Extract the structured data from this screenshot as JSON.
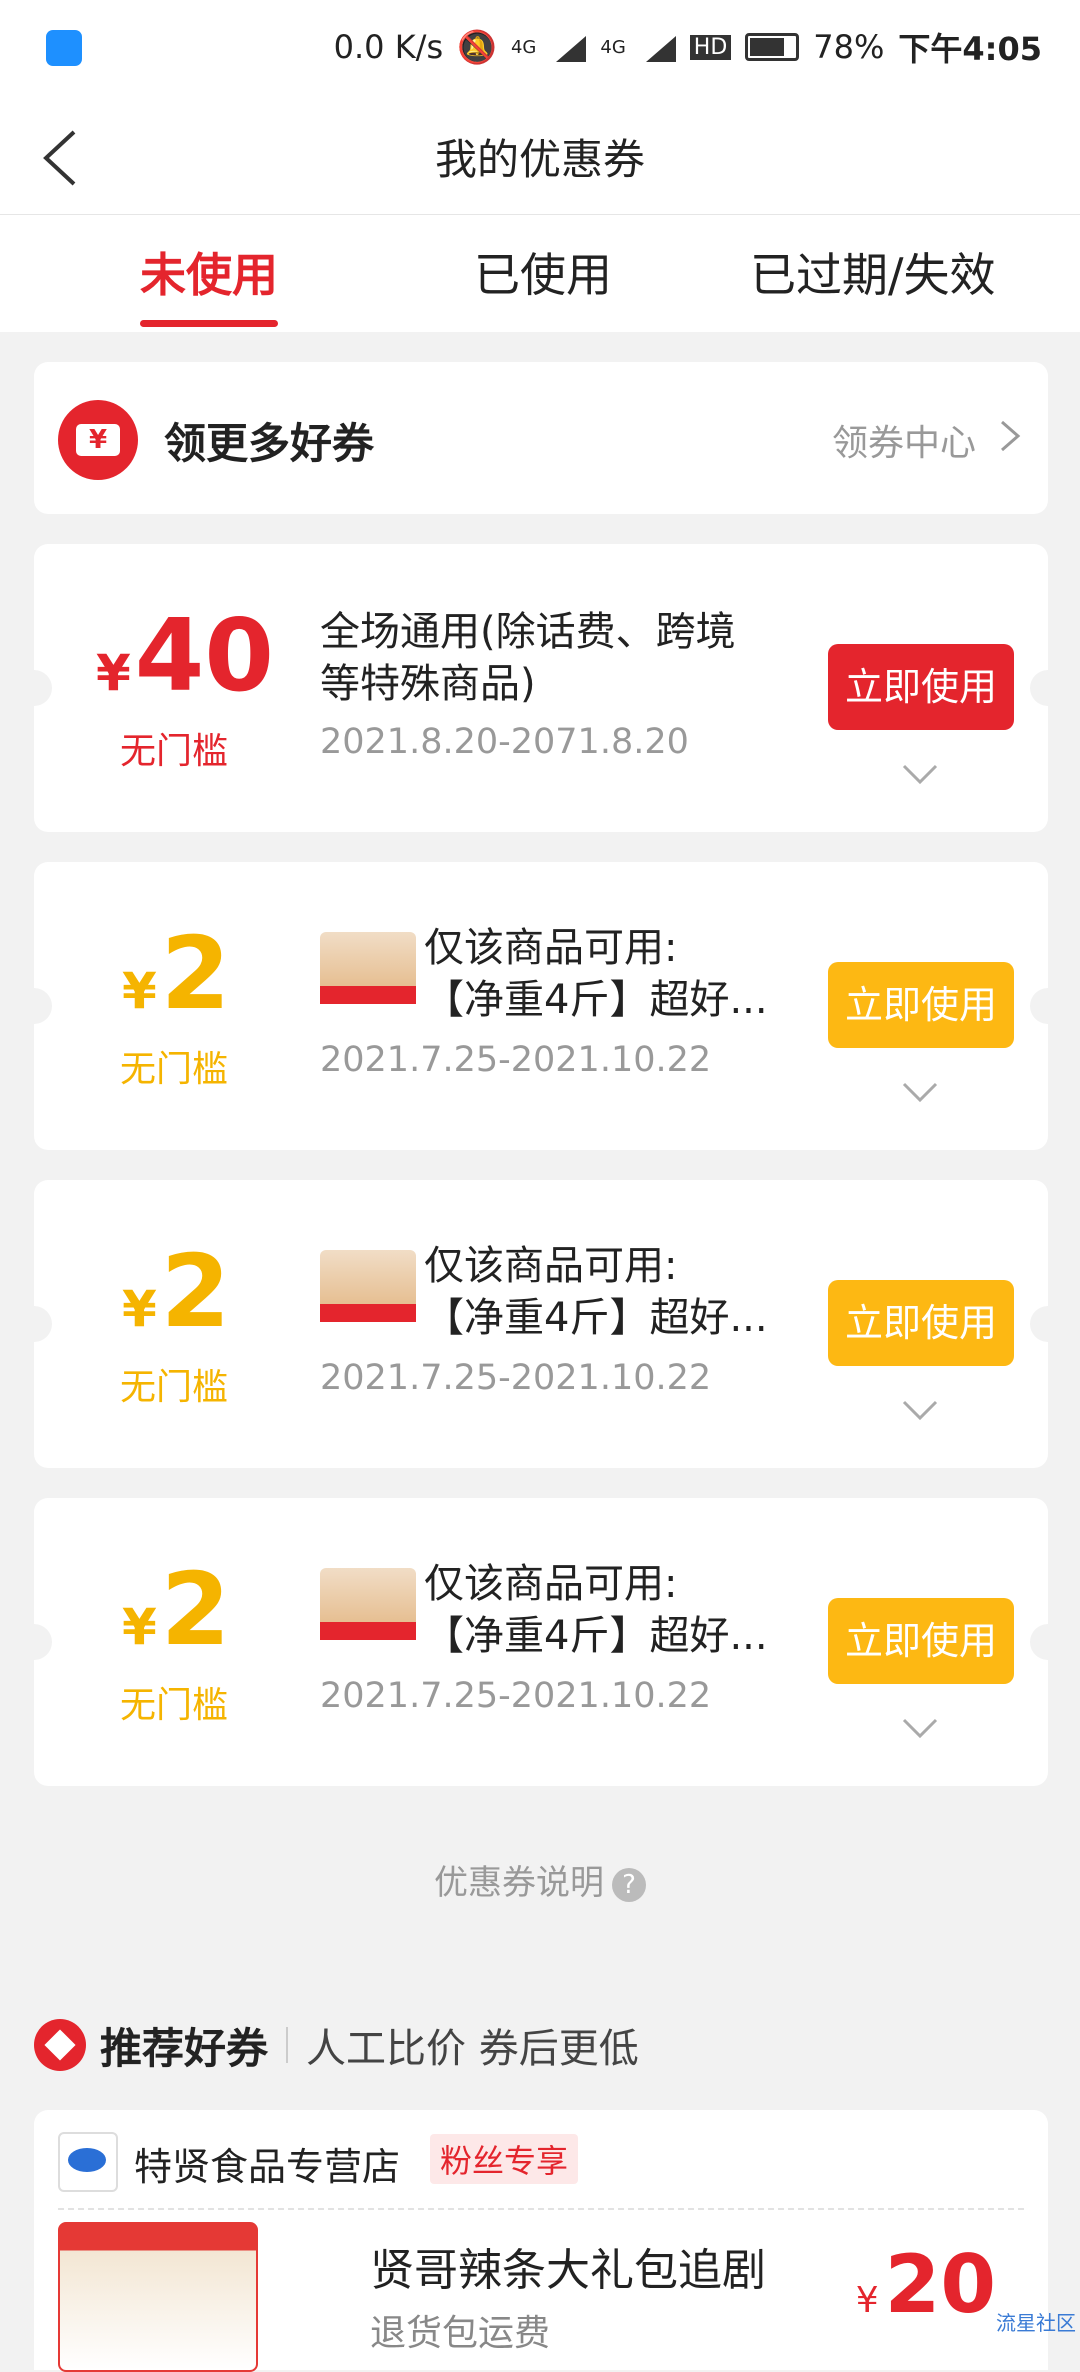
{
  "status_bar": {
    "speed": "0.0 K/s",
    "net1": "4G",
    "net2": "4G",
    "hd": "HD",
    "battery": "78%",
    "time": "下午4:05"
  },
  "header": {
    "title": "我的优惠券"
  },
  "tabs": [
    {
      "label": "未使用",
      "active": true
    },
    {
      "label": "已使用",
      "active": false
    },
    {
      "label": "已过期/失效",
      "active": false
    }
  ],
  "promo": {
    "icon_text": "¥",
    "label": "领更多好券",
    "link": "领券中心"
  },
  "coupons": [
    {
      "currency": "¥",
      "amount": "40",
      "condition": "无门槛",
      "desc": "全场通用(除话费、跨境等特殊商品)",
      "date": "2021.8.20-2071.8.20",
      "button": "立即使用",
      "color": "#e4252d"
    },
    {
      "currency": "¥",
      "amount": "2",
      "condition": "无门槛",
      "desc_line1": "仅该商品可用:",
      "desc_line2": "【净重4斤】超好...",
      "date": "2021.7.25-2021.10.22",
      "button": "立即使用",
      "color": "#f5b400"
    },
    {
      "currency": "¥",
      "amount": "2",
      "condition": "无门槛",
      "desc_line1": "仅该商品可用:",
      "desc_line2": "【净重4斤】超好...",
      "date": "2021.7.25-2021.10.22",
      "button": "立即使用",
      "color": "#f5b400"
    },
    {
      "currency": "¥",
      "amount": "2",
      "condition": "无门槛",
      "desc_line1": "仅该商品可用:",
      "desc_line2": "【净重4斤】超好...",
      "date": "2021.7.25-2021.10.22",
      "button": "立即使用",
      "color": "#f5b400"
    }
  ],
  "explain": {
    "label": "优惠券说明",
    "icon": "?"
  },
  "recommend": {
    "title": "推荐好券",
    "subtitle": "人工比价 券后更低"
  },
  "shop": {
    "name": "特贤食品专营店",
    "badge": "粉丝专享",
    "product_name": "贤哥辣条大礼包追剧",
    "product_sub": "退货包运费",
    "price_currency": "¥",
    "price": "20"
  },
  "watermark": "流星社区"
}
